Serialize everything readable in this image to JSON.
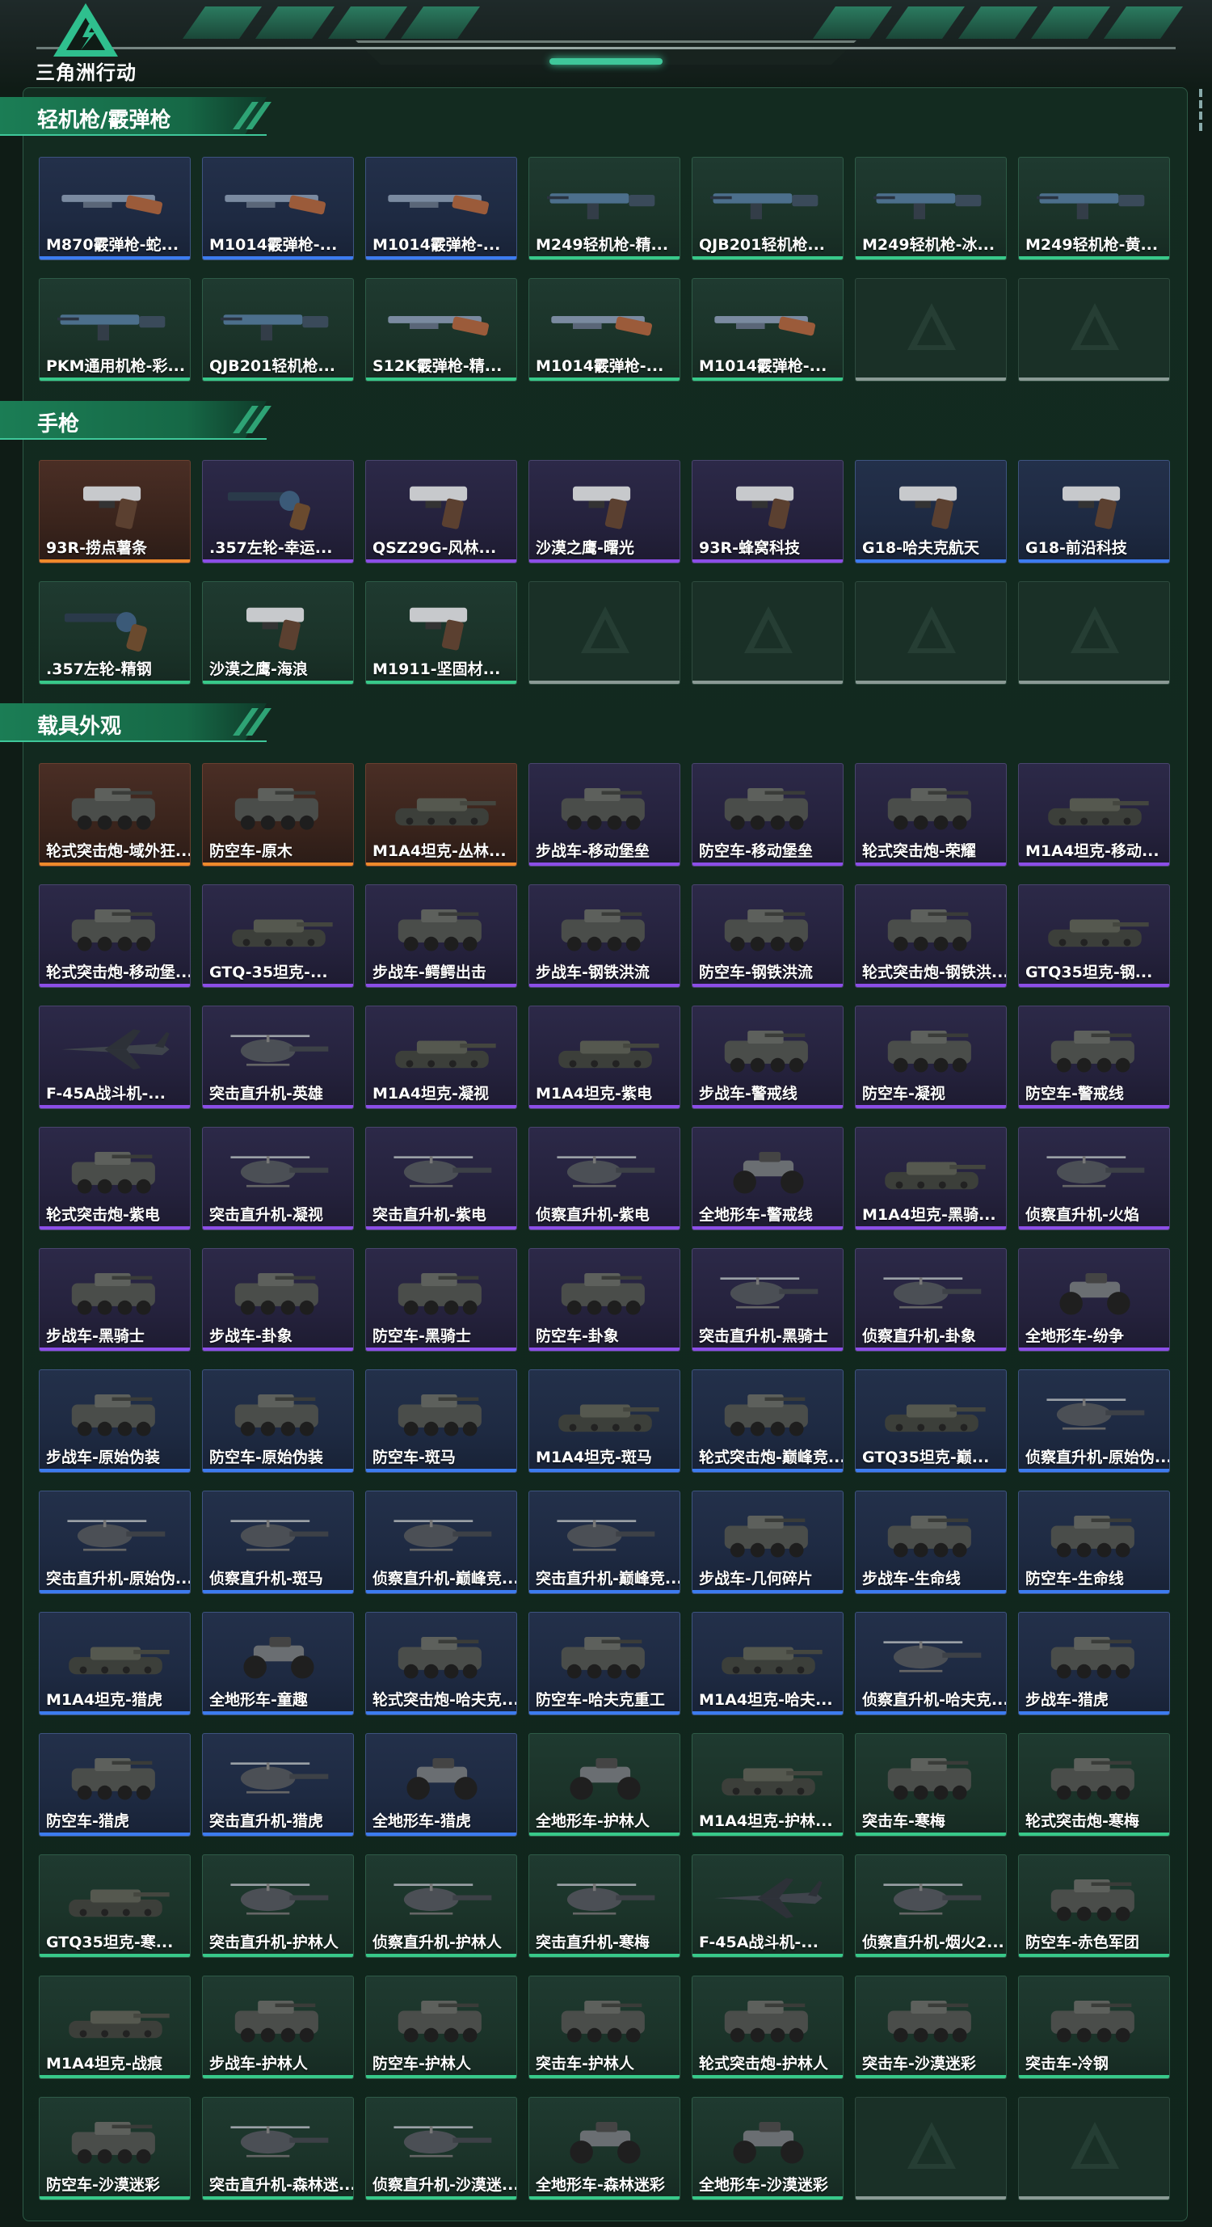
{
  "app": {
    "title": "三角洲行动"
  },
  "colors": {
    "gold": "#ef8a2b",
    "purple": "#8c4ee8",
    "blue": "#3c7cf0",
    "green": "#38c98a",
    "accent": "#3fc79a"
  },
  "sections": [
    {
      "title": "轻机枪/霰弹枪",
      "items": [
        {
          "label": "M870霰弹枪-蛇...",
          "rarity": "blue",
          "icon": "shotgun-icon"
        },
        {
          "label": "M1014霰弹枪-...",
          "rarity": "blue",
          "icon": "shotgun-icon"
        },
        {
          "label": "M1014霰弹枪-...",
          "rarity": "blue",
          "icon": "shotgun-icon"
        },
        {
          "label": "M249轻机枪-精...",
          "rarity": "green",
          "icon": "machine-gun-icon"
        },
        {
          "label": "QJB201轻机枪...",
          "rarity": "green",
          "icon": "machine-gun-icon"
        },
        {
          "label": "M249轻机枪-冰...",
          "rarity": "green",
          "icon": "machine-gun-icon"
        },
        {
          "label": "M249轻机枪-黄...",
          "rarity": "green",
          "icon": "machine-gun-icon"
        },
        {
          "label": "PKM通用机枪-彩...",
          "rarity": "green",
          "icon": "machine-gun-icon"
        },
        {
          "label": "QJB201轻机枪...",
          "rarity": "green",
          "icon": "machine-gun-icon"
        },
        {
          "label": "S12K霰弹枪-精...",
          "rarity": "green",
          "icon": "shotgun-icon"
        },
        {
          "label": "M1014霰弹枪-...",
          "rarity": "green",
          "icon": "shotgun-icon"
        },
        {
          "label": "M1014霰弹枪-...",
          "rarity": "green",
          "icon": "shotgun-icon"
        },
        {
          "label": "",
          "rarity": "empty",
          "icon": "placeholder-logo-icon"
        },
        {
          "label": "",
          "rarity": "empty",
          "icon": "placeholder-logo-icon"
        }
      ]
    },
    {
      "title": "手枪",
      "items": [
        {
          "label": "93R-捞点薯条",
          "rarity": "gold",
          "icon": "pistol-icon"
        },
        {
          "label": ".357左轮-幸运...",
          "rarity": "purple",
          "icon": "revolver-icon"
        },
        {
          "label": "QSZ29G-风林...",
          "rarity": "purple",
          "icon": "pistol-icon"
        },
        {
          "label": "沙漠之鹰-曙光",
          "rarity": "purple",
          "icon": "pistol-icon"
        },
        {
          "label": "93R-蜂窝科技",
          "rarity": "purple",
          "icon": "pistol-icon"
        },
        {
          "label": "G18-哈夫克航天",
          "rarity": "blue",
          "icon": "pistol-icon"
        },
        {
          "label": "G18-前沿科技",
          "rarity": "blue",
          "icon": "pistol-icon"
        },
        {
          "label": ".357左轮-精钢",
          "rarity": "green",
          "icon": "revolver-icon"
        },
        {
          "label": "沙漠之鹰-海浪",
          "rarity": "green",
          "icon": "pistol-icon"
        },
        {
          "label": "M1911-坚固材...",
          "rarity": "green",
          "icon": "pistol-icon"
        },
        {
          "label": "",
          "rarity": "empty",
          "icon": "placeholder-logo-icon"
        },
        {
          "label": "",
          "rarity": "empty",
          "icon": "placeholder-logo-icon"
        },
        {
          "label": "",
          "rarity": "empty",
          "icon": "placeholder-logo-icon"
        },
        {
          "label": "",
          "rarity": "empty",
          "icon": "placeholder-logo-icon"
        }
      ]
    },
    {
      "title": "载具外观",
      "items": [
        {
          "label": "轮式突击炮-域外狂...",
          "rarity": "gold",
          "icon": "armored-car-icon"
        },
        {
          "label": "防空车-原木",
          "rarity": "gold",
          "icon": "armored-car-icon"
        },
        {
          "label": "M1A4坦克-丛林...",
          "rarity": "gold",
          "icon": "tank-icon"
        },
        {
          "label": "步战车-移动堡垒",
          "rarity": "purple",
          "icon": "armored-car-icon"
        },
        {
          "label": "防空车-移动堡垒",
          "rarity": "purple",
          "icon": "armored-car-icon"
        },
        {
          "label": "轮式突击炮-荣耀",
          "rarity": "purple",
          "icon": "armored-car-icon"
        },
        {
          "label": "M1A4坦克-移动...",
          "rarity": "purple",
          "icon": "tank-icon"
        },
        {
          "label": "轮式突击炮-移动堡...",
          "rarity": "purple",
          "icon": "armored-car-icon"
        },
        {
          "label": "GTQ-35坦克-...",
          "rarity": "purple",
          "icon": "tank-icon"
        },
        {
          "label": "步战车-鳄鳄出击",
          "rarity": "purple",
          "icon": "armored-car-icon"
        },
        {
          "label": "步战车-钢铁洪流",
          "rarity": "purple",
          "icon": "armored-car-icon"
        },
        {
          "label": "防空车-钢铁洪流",
          "rarity": "purple",
          "icon": "armored-car-icon"
        },
        {
          "label": "轮式突击炮-钢铁洪...",
          "rarity": "purple",
          "icon": "armored-car-icon"
        },
        {
          "label": "GTQ35坦克-钢...",
          "rarity": "purple",
          "icon": "tank-icon"
        },
        {
          "label": "F-45A战斗机-...",
          "rarity": "purple",
          "icon": "jet-icon"
        },
        {
          "label": "突击直升机-英雄",
          "rarity": "purple",
          "icon": "helicopter-icon"
        },
        {
          "label": "M1A4坦克-凝视",
          "rarity": "purple",
          "icon": "tank-icon"
        },
        {
          "label": "M1A4坦克-紫电",
          "rarity": "purple",
          "icon": "tank-icon"
        },
        {
          "label": "步战车-警戒线",
          "rarity": "purple",
          "icon": "armored-car-icon"
        },
        {
          "label": "防空车-凝视",
          "rarity": "purple",
          "icon": "armored-car-icon"
        },
        {
          "label": "防空车-警戒线",
          "rarity": "purple",
          "icon": "armored-car-icon"
        },
        {
          "label": "轮式突击炮-紫电",
          "rarity": "purple",
          "icon": "armored-car-icon"
        },
        {
          "label": "突击直升机-凝视",
          "rarity": "purple",
          "icon": "helicopter-icon"
        },
        {
          "label": "突击直升机-紫电",
          "rarity": "purple",
          "icon": "helicopter-icon"
        },
        {
          "label": "侦察直升机-紫电",
          "rarity": "purple",
          "icon": "helicopter-icon"
        },
        {
          "label": "全地形车-警戒线",
          "rarity": "purple",
          "icon": "atv-icon"
        },
        {
          "label": "M1A4坦克-黑骑...",
          "rarity": "purple",
          "icon": "tank-icon"
        },
        {
          "label": "侦察直升机-火焰",
          "rarity": "purple",
          "icon": "helicopter-icon"
        },
        {
          "label": "步战车-黑骑士",
          "rarity": "purple",
          "icon": "armored-car-icon"
        },
        {
          "label": "步战车-卦象",
          "rarity": "purple",
          "icon": "armored-car-icon"
        },
        {
          "label": "防空车-黑骑士",
          "rarity": "purple",
          "icon": "armored-car-icon"
        },
        {
          "label": "防空车-卦象",
          "rarity": "purple",
          "icon": "armored-car-icon"
        },
        {
          "label": "突击直升机-黑骑士",
          "rarity": "purple",
          "icon": "helicopter-icon"
        },
        {
          "label": "侦察直升机-卦象",
          "rarity": "purple",
          "icon": "helicopter-icon"
        },
        {
          "label": "全地形车-纷争",
          "rarity": "purple",
          "icon": "atv-icon"
        },
        {
          "label": "步战车-原始伪装",
          "rarity": "blue",
          "icon": "armored-car-icon"
        },
        {
          "label": "防空车-原始伪装",
          "rarity": "blue",
          "icon": "armored-car-icon"
        },
        {
          "label": "防空车-斑马",
          "rarity": "blue",
          "icon": "armored-car-icon"
        },
        {
          "label": "M1A4坦克-斑马",
          "rarity": "blue",
          "icon": "tank-icon"
        },
        {
          "label": "轮式突击炮-巅峰竞...",
          "rarity": "blue",
          "icon": "armored-car-icon"
        },
        {
          "label": "GTQ35坦克-巅...",
          "rarity": "blue",
          "icon": "tank-icon"
        },
        {
          "label": "侦察直升机-原始伪...",
          "rarity": "blue",
          "icon": "helicopter-icon"
        },
        {
          "label": "突击直升机-原始伪...",
          "rarity": "blue",
          "icon": "helicopter-icon"
        },
        {
          "label": "侦察直升机-斑马",
          "rarity": "blue",
          "icon": "helicopter-icon"
        },
        {
          "label": "侦察直升机-巅峰竞...",
          "rarity": "blue",
          "icon": "helicopter-icon"
        },
        {
          "label": "突击直升机-巅峰竞...",
          "rarity": "blue",
          "icon": "helicopter-icon"
        },
        {
          "label": "步战车-几何碎片",
          "rarity": "blue",
          "icon": "armored-car-icon"
        },
        {
          "label": "步战车-生命线",
          "rarity": "blue",
          "icon": "armored-car-icon"
        },
        {
          "label": "防空车-生命线",
          "rarity": "blue",
          "icon": "armored-car-icon"
        },
        {
          "label": "M1A4坦克-猎虎",
          "rarity": "blue",
          "icon": "tank-icon"
        },
        {
          "label": "全地形车-童趣",
          "rarity": "blue",
          "icon": "atv-icon"
        },
        {
          "label": "轮式突击炮-哈夫克...",
          "rarity": "blue",
          "icon": "armored-car-icon"
        },
        {
          "label": "防空车-哈夫克重工",
          "rarity": "blue",
          "icon": "armored-car-icon"
        },
        {
          "label": "M1A4坦克-哈夫...",
          "rarity": "blue",
          "icon": "tank-icon"
        },
        {
          "label": "侦察直升机-哈夫克...",
          "rarity": "blue",
          "icon": "helicopter-icon"
        },
        {
          "label": "步战车-猎虎",
          "rarity": "blue",
          "icon": "armored-car-icon"
        },
        {
          "label": "防空车-猎虎",
          "rarity": "blue",
          "icon": "armored-car-icon"
        },
        {
          "label": "突击直升机-猎虎",
          "rarity": "blue",
          "icon": "helicopter-icon"
        },
        {
          "label": "全地形车-猎虎",
          "rarity": "blue",
          "icon": "atv-icon"
        },
        {
          "label": "全地形车-护林人",
          "rarity": "green",
          "icon": "atv-icon"
        },
        {
          "label": "M1A4坦克-护林...",
          "rarity": "green",
          "icon": "tank-icon"
        },
        {
          "label": "突击车-寒梅",
          "rarity": "green",
          "icon": "armored-car-icon"
        },
        {
          "label": "轮式突击炮-寒梅",
          "rarity": "green",
          "icon": "armored-car-icon"
        },
        {
          "label": "GTQ35坦克-寒...",
          "rarity": "green",
          "icon": "tank-icon"
        },
        {
          "label": "突击直升机-护林人",
          "rarity": "green",
          "icon": "helicopter-icon"
        },
        {
          "label": "侦察直升机-护林人",
          "rarity": "green",
          "icon": "helicopter-icon"
        },
        {
          "label": "突击直升机-寒梅",
          "rarity": "green",
          "icon": "helicopter-icon"
        },
        {
          "label": "F-45A战斗机-...",
          "rarity": "green",
          "icon": "jet-icon"
        },
        {
          "label": "侦察直升机-烟火2...",
          "rarity": "green",
          "icon": "helicopter-icon"
        },
        {
          "label": "防空车-赤色军团",
          "rarity": "green",
          "icon": "armored-car-icon"
        },
        {
          "label": "M1A4坦克-战痕",
          "rarity": "green",
          "icon": "tank-icon"
        },
        {
          "label": "步战车-护林人",
          "rarity": "green",
          "icon": "armored-car-icon"
        },
        {
          "label": "防空车-护林人",
          "rarity": "green",
          "icon": "armored-car-icon"
        },
        {
          "label": "突击车-护林人",
          "rarity": "green",
          "icon": "armored-car-icon"
        },
        {
          "label": "轮式突击炮-护林人",
          "rarity": "green",
          "icon": "armored-car-icon"
        },
        {
          "label": "突击车-沙漠迷彩",
          "rarity": "green",
          "icon": "armored-car-icon"
        },
        {
          "label": "突击车-冷钢",
          "rarity": "green",
          "icon": "armored-car-icon"
        },
        {
          "label": "防空车-沙漠迷彩",
          "rarity": "green",
          "icon": "armored-car-icon"
        },
        {
          "label": "突击直升机-森林迷...",
          "rarity": "green",
          "icon": "helicopter-icon"
        },
        {
          "label": "侦察直升机-沙漠迷...",
          "rarity": "green",
          "icon": "helicopter-icon"
        },
        {
          "label": "全地形车-森林迷彩",
          "rarity": "green",
          "icon": "atv-icon"
        },
        {
          "label": "全地形车-沙漠迷彩",
          "rarity": "green",
          "icon": "atv-icon"
        },
        {
          "label": "",
          "rarity": "empty",
          "icon": "placeholder-logo-icon"
        },
        {
          "label": "",
          "rarity": "empty",
          "icon": "placeholder-logo-icon"
        }
      ]
    }
  ]
}
